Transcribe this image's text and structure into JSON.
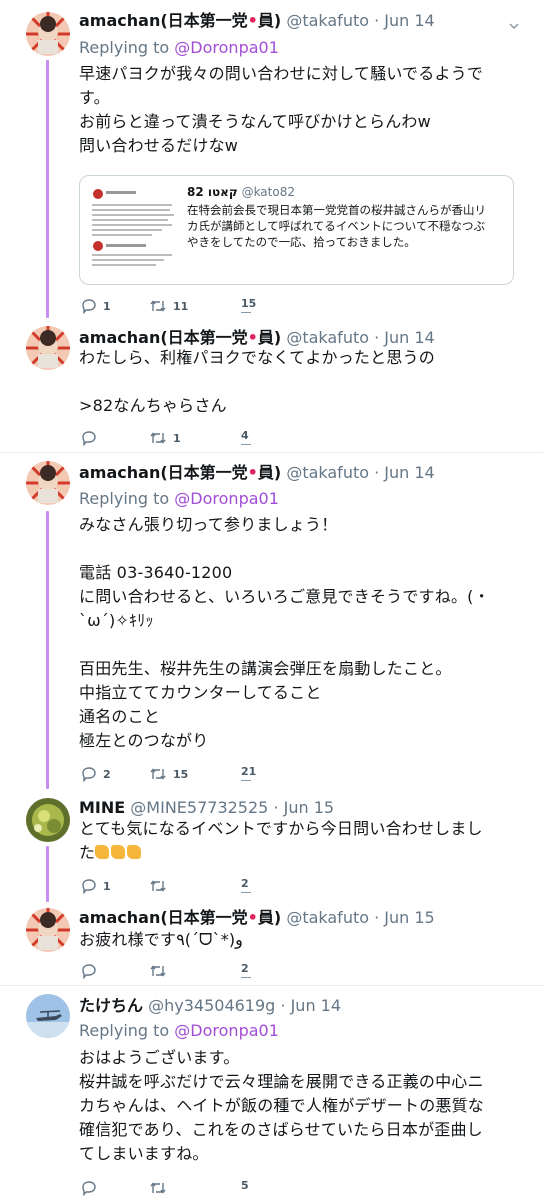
{
  "tweets": [
    {
      "name": "amachan(日本第一党",
      "name_dot": "•",
      "name_tail": "員)",
      "handle": "@takafuto",
      "time": "Jun 14",
      "reply_prefix": "Replying to ",
      "reply_to": "@Doronpa01",
      "lines": [
        "早速パヨクが我々の問い合わせに対して騒いでるようで",
        "す。",
        "お前らと違って潰そうなんて呼びかけとらんわw",
        "問い合わせるだけなw"
      ],
      "quote": {
        "name": "82 קאטו",
        "handle": "@kato82",
        "lines": [
          "在特会前会長で現日本第一党党首の桜井誠さんらが香山リ",
          "カ氏が講師として呼ばれてるイベントについて不穏なつぶ",
          "やきをしてたので一応、拾っておきました。"
        ]
      },
      "replies": "1",
      "retweets": "11",
      "likes": "15"
    },
    {
      "name": "amachan(日本第一党",
      "name_dot": "•",
      "name_tail": "員)",
      "handle": "@takafuto",
      "time": "Jun 14",
      "lines": [
        "わたしら、利権パヨクでなくてよかったと思うの",
        "",
        ">82なんちゃらさん"
      ],
      "replies": "",
      "retweets": "1",
      "likes": "4"
    },
    {
      "name": "amachan(日本第一党",
      "name_dot": "•",
      "name_tail": "員)",
      "handle": "@takafuto",
      "time": "Jun 14",
      "reply_prefix": "Replying to ",
      "reply_to": "@Doronpa01",
      "lines": [
        "みなさん張り切って参りましょう！",
        "",
        "電話 03-3640-1200",
        "に問い合わせると、いろいろご意見できそうですね。(・",
        "`ω´)✧ｷﾘｯ",
        "",
        "百田先生、桜井先生の講演会弾圧を扇動したこと。",
        "中指立ててカウンターしてること",
        "通名のこと",
        "極左とのつながり"
      ],
      "replies": "2",
      "retweets": "15",
      "likes": "21"
    },
    {
      "name": "MINE",
      "handle": "@MINE57732525",
      "time": "Jun 15",
      "lines": [
        "とても気になるイベントですから今日問い合わせしまし",
        "た"
      ],
      "replies": "1",
      "retweets": "",
      "likes": "2"
    },
    {
      "name": "amachan(日本第一党",
      "name_dot": "•",
      "name_tail": "員)",
      "handle": "@takafuto",
      "time": "Jun 15",
      "lines": [
        "お疲れ様です٩(´ᗜ`*)و"
      ],
      "replies": "",
      "retweets": "",
      "likes": "2"
    },
    {
      "name": "たけちん",
      "handle": "@hy34504619g",
      "time": "Jun 14",
      "reply_prefix": "Replying to ",
      "reply_to": "@Doronpa01",
      "lines": [
        "おはようございます。",
        "桜井誠を呼ぶだけで云々理論を展開できる正義の中心ニ",
        "カちゃんは、ヘイトが飯の種で人権がデザートの悪質な",
        "確信犯であり、これをのさばらせていたら日本が歪曲し",
        "てしまいますね。"
      ],
      "replies": "",
      "retweets": "",
      "likes": "5"
    }
  ],
  "colors": {
    "thread_line": "#c78df0",
    "mention": "#a24dd6",
    "secondary": "#657786",
    "divider": "#e6ecf0"
  },
  "icons": [
    "reply-icon",
    "retweet-icon",
    "like-icon",
    "caret-down-icon"
  ]
}
